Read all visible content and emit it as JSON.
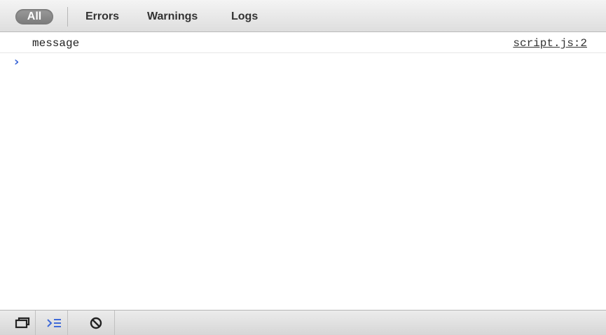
{
  "filters": {
    "all": "All",
    "errors": "Errors",
    "warnings": "Warnings",
    "logs": "Logs"
  },
  "console": {
    "messages": [
      {
        "text": "message",
        "source": "script.js:2"
      }
    ],
    "prompt_symbol": "›"
  },
  "bottom_toolbar": {
    "icons": [
      "dock-toggle-icon",
      "console-drawer-icon",
      "clear-console-icon"
    ]
  },
  "colors": {
    "accent": "#3f6ad8",
    "selected_filter_bg": "#8a8a8a"
  }
}
